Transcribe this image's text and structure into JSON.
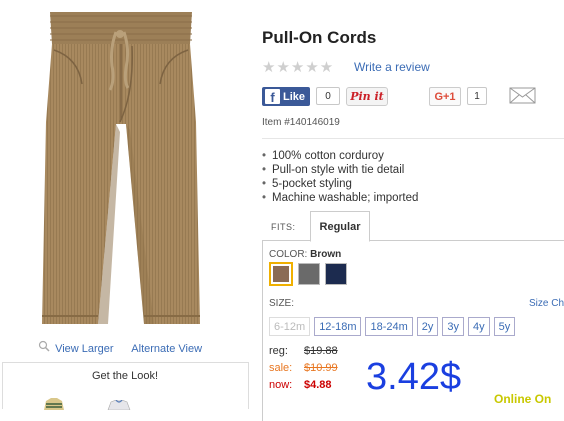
{
  "product": {
    "title": "Pull-On Cords",
    "item_number": "Item #140146019",
    "review_link": "Write a review",
    "stars": "★★★★★",
    "features": [
      "100% cotton corduroy",
      "Pull-on style with tie detail",
      "5-pocket styling",
      "Machine washable; imported"
    ]
  },
  "social": {
    "like_label": "Like",
    "like_count": "0",
    "pin_label": "Pin it",
    "gplus_label": "G+1",
    "gplus_count": "1"
  },
  "image_links": {
    "view_larger": "View Larger",
    "alternate_view": "Alternate View",
    "get_the_look": "Get the Look!"
  },
  "fits": {
    "label": "FITS:",
    "selected_tab": "Regular"
  },
  "color": {
    "label": "COLOR:",
    "selected": "Brown",
    "swatches": [
      "#8b6c55",
      "#6a6a6a",
      "#1c2b4f"
    ]
  },
  "size": {
    "label": "SIZE:",
    "chart_link": "Size Ch",
    "options": [
      {
        "label": "6-12m",
        "available": false
      },
      {
        "label": "12-18m",
        "available": true
      },
      {
        "label": "18-24m",
        "available": true
      },
      {
        "label": "2y",
        "available": true
      },
      {
        "label": "3y",
        "available": true
      },
      {
        "label": "4y",
        "available": true
      },
      {
        "label": "5y",
        "available": true
      }
    ]
  },
  "pricing": {
    "reg_label": "reg:",
    "reg_value": "$19.88",
    "sale_label": "sale:",
    "sale_value": "$10.99",
    "now_label": "now:",
    "now_value": "$4.88",
    "overlay_price": "3.42$",
    "online_only": "Online On"
  }
}
